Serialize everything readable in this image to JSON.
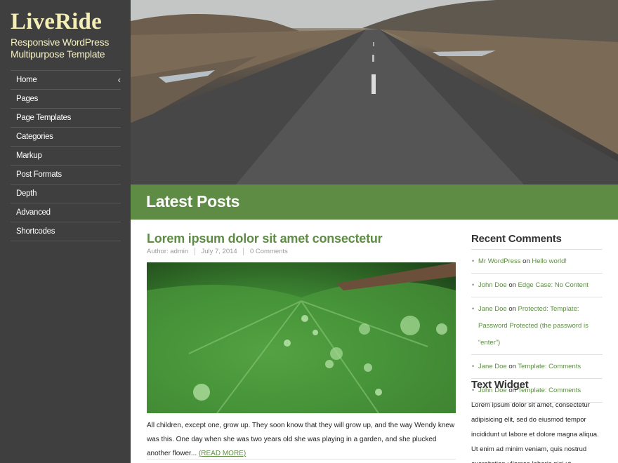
{
  "site": {
    "title": "LiveRide",
    "tagline": "Responsive WordPress Multipurpose Template"
  },
  "nav": {
    "items": [
      {
        "label": "Home"
      },
      {
        "label": "Pages"
      },
      {
        "label": "Page Templates"
      },
      {
        "label": "Categories"
      },
      {
        "label": "Markup"
      },
      {
        "label": "Post Formats"
      },
      {
        "label": "Depth"
      },
      {
        "label": "Advanced"
      },
      {
        "label": "Shortcodes"
      }
    ],
    "expand_icon": "chevron-left-icon"
  },
  "banner": {
    "heading": "Latest Posts"
  },
  "post": {
    "title": "Lorem ipsum dolor sit amet consectetur",
    "meta": {
      "author_prefix": "Author:",
      "author": "admin",
      "date": "July 7, 2014",
      "comments": "0 Comments"
    },
    "excerpt": "All children, except one, grow up. They soon know that they will grow up, and the way Wendy knew was this. One day when she was two years old she was playing in a garden, and she plucked another flower...",
    "read_more": "(READ MORE)"
  },
  "recent_comments": {
    "title": "Recent Comments",
    "on_word": "on",
    "items": [
      {
        "author": "Mr WordPress",
        "post": "Hello world!"
      },
      {
        "author": "John Doe",
        "post": "Edge Case: No Content"
      },
      {
        "author": "Jane Doe",
        "post": "Protected: Template: Password Protected (the password is “enter”)"
      },
      {
        "author": "Jane Doe",
        "post": "Template: Comments"
      },
      {
        "author": "John Doe",
        "post": "Template: Comments"
      }
    ]
  },
  "text_widget": {
    "title": "Text Widget",
    "body": "Lorem ipsum dolor sit amet, consectetur adipisicing elit, sed do eiusmod tempor incididunt ut labore et dolore magna aliqua. Ut enim ad minim veniam, quis nostrud exercitation ullamco laboris nisi ut"
  },
  "colors": {
    "sidebar_bg": "#3f3f3f",
    "accent_green": "#5e8c45",
    "logo_cream": "#f3efb6"
  }
}
